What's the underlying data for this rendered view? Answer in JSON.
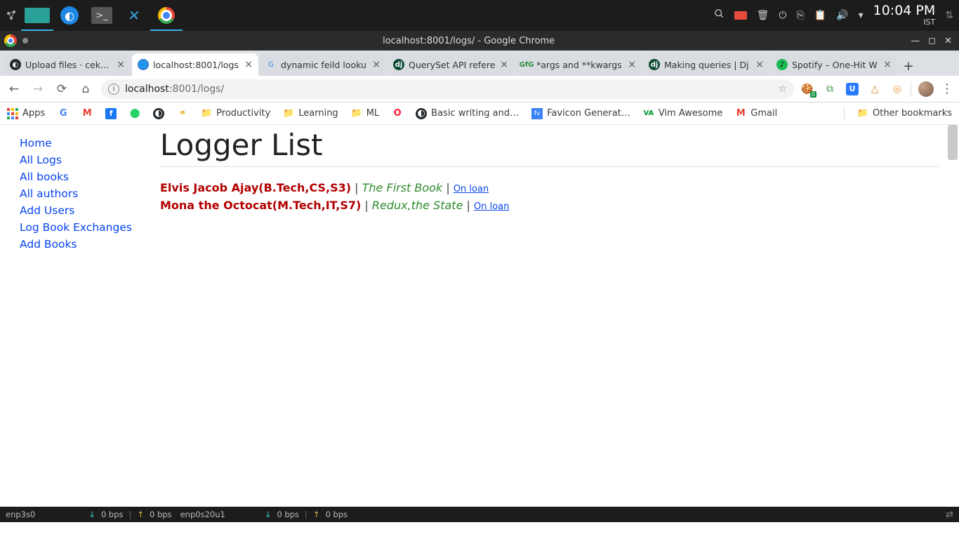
{
  "desktop": {
    "clock_time": "10:04 PM",
    "clock_zone": "IST",
    "bottom": {
      "if1": "enp3s0",
      "if1_up": "0 bps",
      "if1_down": "0 bps",
      "if2": "enp0s20u1",
      "if2_up": "0 bps",
      "if2_down": "0 bps"
    }
  },
  "window": {
    "title": "localhost:8001/logs/ - Google Chrome"
  },
  "tabs": [
    {
      "label": "Upload files · cek-op",
      "icon": "gh"
    },
    {
      "label": "localhost:8001/logs",
      "icon": "globe",
      "active": true
    },
    {
      "label": "dynamic feild looku",
      "icon": "google-g"
    },
    {
      "label": "QuerySet API refere",
      "icon": "dj"
    },
    {
      "label": "*args and **kwargs",
      "icon": "gfg"
    },
    {
      "label": "Making queries | Dj",
      "icon": "dj"
    },
    {
      "label": "Spotify – One-Hit W",
      "icon": "spot"
    }
  ],
  "omnibox": {
    "host": "localhost",
    "path": ":8001/logs/"
  },
  "bookmarks": [
    {
      "label": "Apps",
      "icon": "apps"
    },
    {
      "label": "",
      "icon": "google-g"
    },
    {
      "label": "",
      "icon": "gmail"
    },
    {
      "label": "",
      "icon": "fb"
    },
    {
      "label": "",
      "icon": "wa"
    },
    {
      "label": "",
      "icon": "gh"
    },
    {
      "label": "",
      "icon": "link"
    },
    {
      "label": "Productivity",
      "icon": "folder"
    },
    {
      "label": "Learning",
      "icon": "folder"
    },
    {
      "label": "ML",
      "icon": "folder"
    },
    {
      "label": "",
      "icon": "opera"
    },
    {
      "label": "Basic writing and…",
      "icon": "gh"
    },
    {
      "label": "Favicon Generat…",
      "icon": "favgen"
    },
    {
      "label": "Vim Awesome",
      "icon": "va"
    },
    {
      "label": "Gmail",
      "icon": "gmail"
    }
  ],
  "other_bookmarks_label": "Other bookmarks",
  "sidebar": {
    "items": [
      "Home",
      "All Logs",
      "All books",
      "All authors",
      "Add Users",
      "Log Book Exchanges",
      "Add Books"
    ]
  },
  "page": {
    "heading": "Logger List",
    "logs": [
      {
        "user": "Elvis Jacob Ajay(B.Tech,CS,S3)",
        "book": "The First Book",
        "status": "On loan"
      },
      {
        "user": "Mona the Octocat(M.Tech,IT,S7)",
        "book": "Redux,the State",
        "status": "On loan"
      }
    ]
  }
}
